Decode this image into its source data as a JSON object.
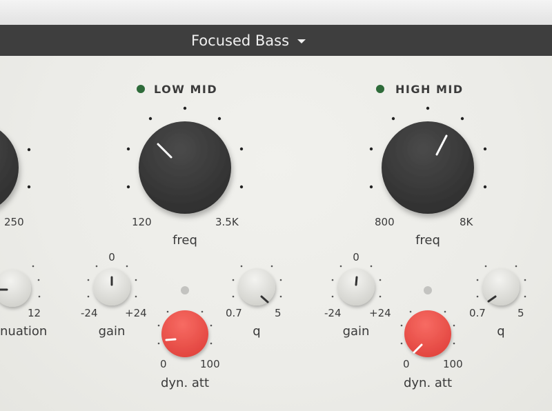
{
  "preset": {
    "name": "Focused Bass"
  },
  "bands": {
    "left_partial": {
      "freq_max_label": "250",
      "attenuation_max_label": "12",
      "attenuation_label": "nuation"
    },
    "low_mid": {
      "title": "LOW MID",
      "indicator_color": "#2e6b3a",
      "freq": {
        "label": "freq",
        "min_label": "120",
        "max_label": "3.5K"
      },
      "gain": {
        "label": "gain",
        "top_label": "0",
        "min_label": "-24",
        "max_label": "+24"
      },
      "q": {
        "label": "q",
        "min_label": "0.7",
        "max_label": "5"
      },
      "dyn_att": {
        "label": "dyn. att",
        "min_label": "0",
        "max_label": "100"
      }
    },
    "high_mid": {
      "title": "HIGH MID",
      "indicator_color": "#2e6b3a",
      "freq": {
        "label": "freq",
        "min_label": "800",
        "max_label": "8K"
      },
      "gain": {
        "label": "gain",
        "top_label": "0",
        "min_label": "-24",
        "max_label": "+24"
      },
      "q": {
        "label": "q",
        "min_label": "0.7",
        "max_label": "5"
      },
      "dyn_att": {
        "label": "dyn. att",
        "min_label": "0",
        "max_label": "100"
      }
    }
  },
  "colors": {
    "knob_dark": "#3b3b3b",
    "knob_red": "#ee5750",
    "knob_light": "#e4e4e0",
    "header": "#3e3e3e"
  }
}
